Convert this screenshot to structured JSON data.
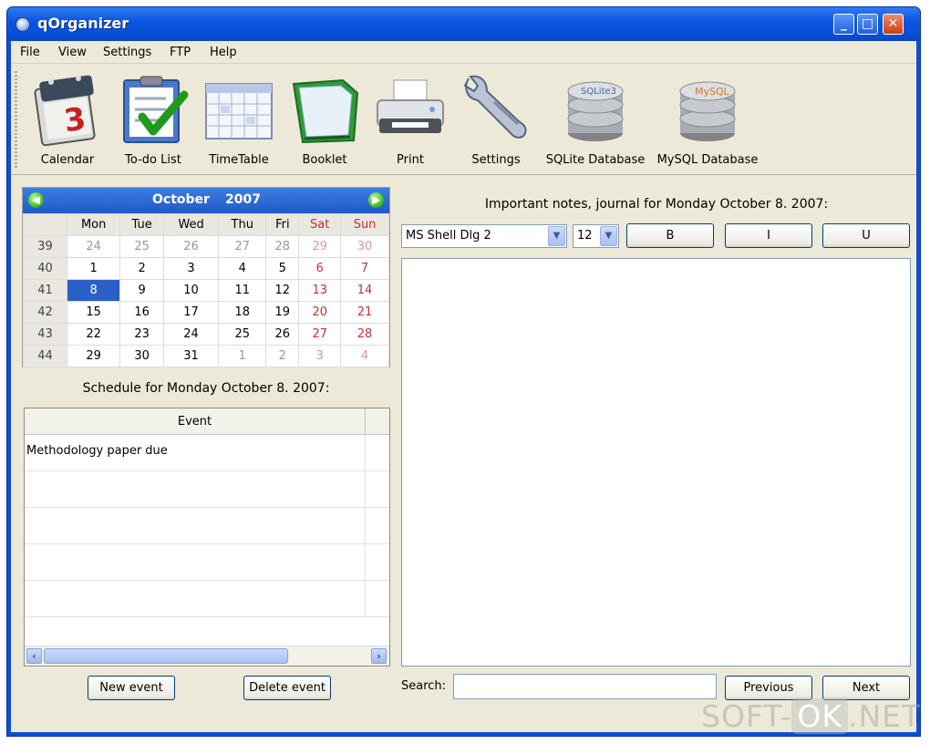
{
  "window": {
    "title": "qOrganizer"
  },
  "menu": [
    "File",
    "View",
    "Settings",
    "FTP",
    "Help"
  ],
  "toolbar": [
    {
      "label": "Calendar",
      "icon": "calendar-icon"
    },
    {
      "label": "To-do List",
      "icon": "todo-list-icon"
    },
    {
      "label": "TimeTable",
      "icon": "timetable-icon"
    },
    {
      "label": "Booklet",
      "icon": "booklet-icon"
    },
    {
      "label": "Print",
      "icon": "printer-icon"
    },
    {
      "label": "Settings",
      "icon": "wrench-icon"
    },
    {
      "label": "SQLite Database",
      "icon": "sqlite-database-icon"
    },
    {
      "label": "MySQL Database",
      "icon": "mysql-database-icon"
    }
  ],
  "toolbar_icon_text": {
    "calendar_day": "3",
    "sqlite": "SQLite3",
    "mysql": "MySQL"
  },
  "calendar": {
    "month": "October",
    "year": "2007",
    "weekdays": [
      "Mon",
      "Tue",
      "Wed",
      "Thu",
      "Fri",
      "Sat",
      "Sun"
    ],
    "weeks": [
      {
        "week": "39",
        "days": [
          "24",
          "25",
          "26",
          "27",
          "28",
          "29",
          "30"
        ]
      },
      {
        "week": "40",
        "days": [
          "1",
          "2",
          "3",
          "4",
          "5",
          "6",
          "7"
        ]
      },
      {
        "week": "41",
        "days": [
          "8",
          "9",
          "10",
          "11",
          "12",
          "13",
          "14"
        ]
      },
      {
        "week": "42",
        "days": [
          "15",
          "16",
          "17",
          "18",
          "19",
          "20",
          "21"
        ]
      },
      {
        "week": "43",
        "days": [
          "22",
          "23",
          "24",
          "25",
          "26",
          "27",
          "28"
        ]
      },
      {
        "week": "44",
        "days": [
          "29",
          "30",
          "31",
          "1",
          "2",
          "3",
          "4"
        ]
      }
    ],
    "selected_day": "8"
  },
  "schedule": {
    "title": "Schedule for Monday October 8. 2007:",
    "column_event": "Event",
    "rows": [
      "Methodology paper due",
      "",
      "",
      "",
      "",
      ""
    ],
    "new_event": "New event",
    "delete_event": "Delete event"
  },
  "notes": {
    "title": "Important notes, journal for Monday October 8. 2007:",
    "font": "MS Shell Dlg 2",
    "size": "12",
    "bold": "B",
    "italic": "I",
    "underline": "U"
  },
  "search": {
    "label": "Search:",
    "value": "",
    "previous": "Previous",
    "next": "Next"
  },
  "colors": {
    "titlebar": "#0b56e0",
    "calendar_header": "#2a5fc8",
    "weekend": "#c83030",
    "face": "#ece9d8"
  },
  "watermark": {
    "pre": "SOFT-",
    "ok": "OK",
    "post": ".NET"
  }
}
